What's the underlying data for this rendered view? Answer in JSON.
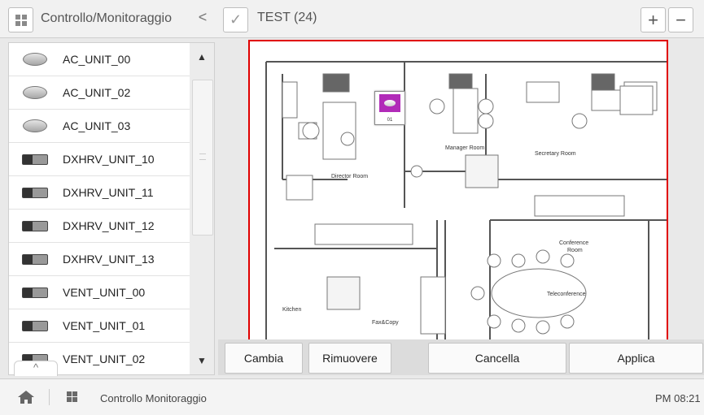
{
  "header": {
    "title": "Controllo/Monitoraggio",
    "back_glyph": "<",
    "group_label": "TEST (24)",
    "plus_glyph": "+",
    "minus_glyph": "−"
  },
  "device_list": {
    "items": [
      {
        "label": "AC_UNIT_00",
        "icon": "ceiling-cassette-icon"
      },
      {
        "label": "AC_UNIT_02",
        "icon": "ceiling-cassette-icon"
      },
      {
        "label": "AC_UNIT_03",
        "icon": "ceiling-cassette-icon"
      },
      {
        "label": "DXHRV_UNIT_10",
        "icon": "ventilation-unit-icon"
      },
      {
        "label": "DXHRV_UNIT_11",
        "icon": "ventilation-unit-icon"
      },
      {
        "label": "DXHRV_UNIT_12",
        "icon": "ventilation-unit-icon"
      },
      {
        "label": "DXHRV_UNIT_13",
        "icon": "ventilation-unit-icon"
      },
      {
        "label": "VENT_UNIT_00",
        "icon": "ventilation-unit-icon"
      },
      {
        "label": "VENT_UNIT_01",
        "icon": "ventilation-unit-icon"
      },
      {
        "label": "VENT_UNIT_02",
        "icon": "ventilation-unit-icon"
      }
    ],
    "scroll_up": "▲",
    "scroll_down": "▼",
    "expand_glyph": "^"
  },
  "floorplan": {
    "room_labels": {
      "director": "Director Room",
      "manager": "Manager Room",
      "secretary": "Secretary Room",
      "conference": "Conference",
      "conference_2": "Room",
      "teleconference": "Teleconference",
      "kitchen": "Kitchen",
      "fax": "Fax&Copy"
    },
    "marker": {
      "number": "01",
      "color": "#b12bb8"
    },
    "border_color": "#e00000"
  },
  "actions": {
    "change": "Cambia",
    "remove": "Rimuovere",
    "cancel": "Cancella",
    "apply": "Applica"
  },
  "footer": {
    "title": "Controllo Monitoraggio",
    "time": "PM 08:21"
  }
}
